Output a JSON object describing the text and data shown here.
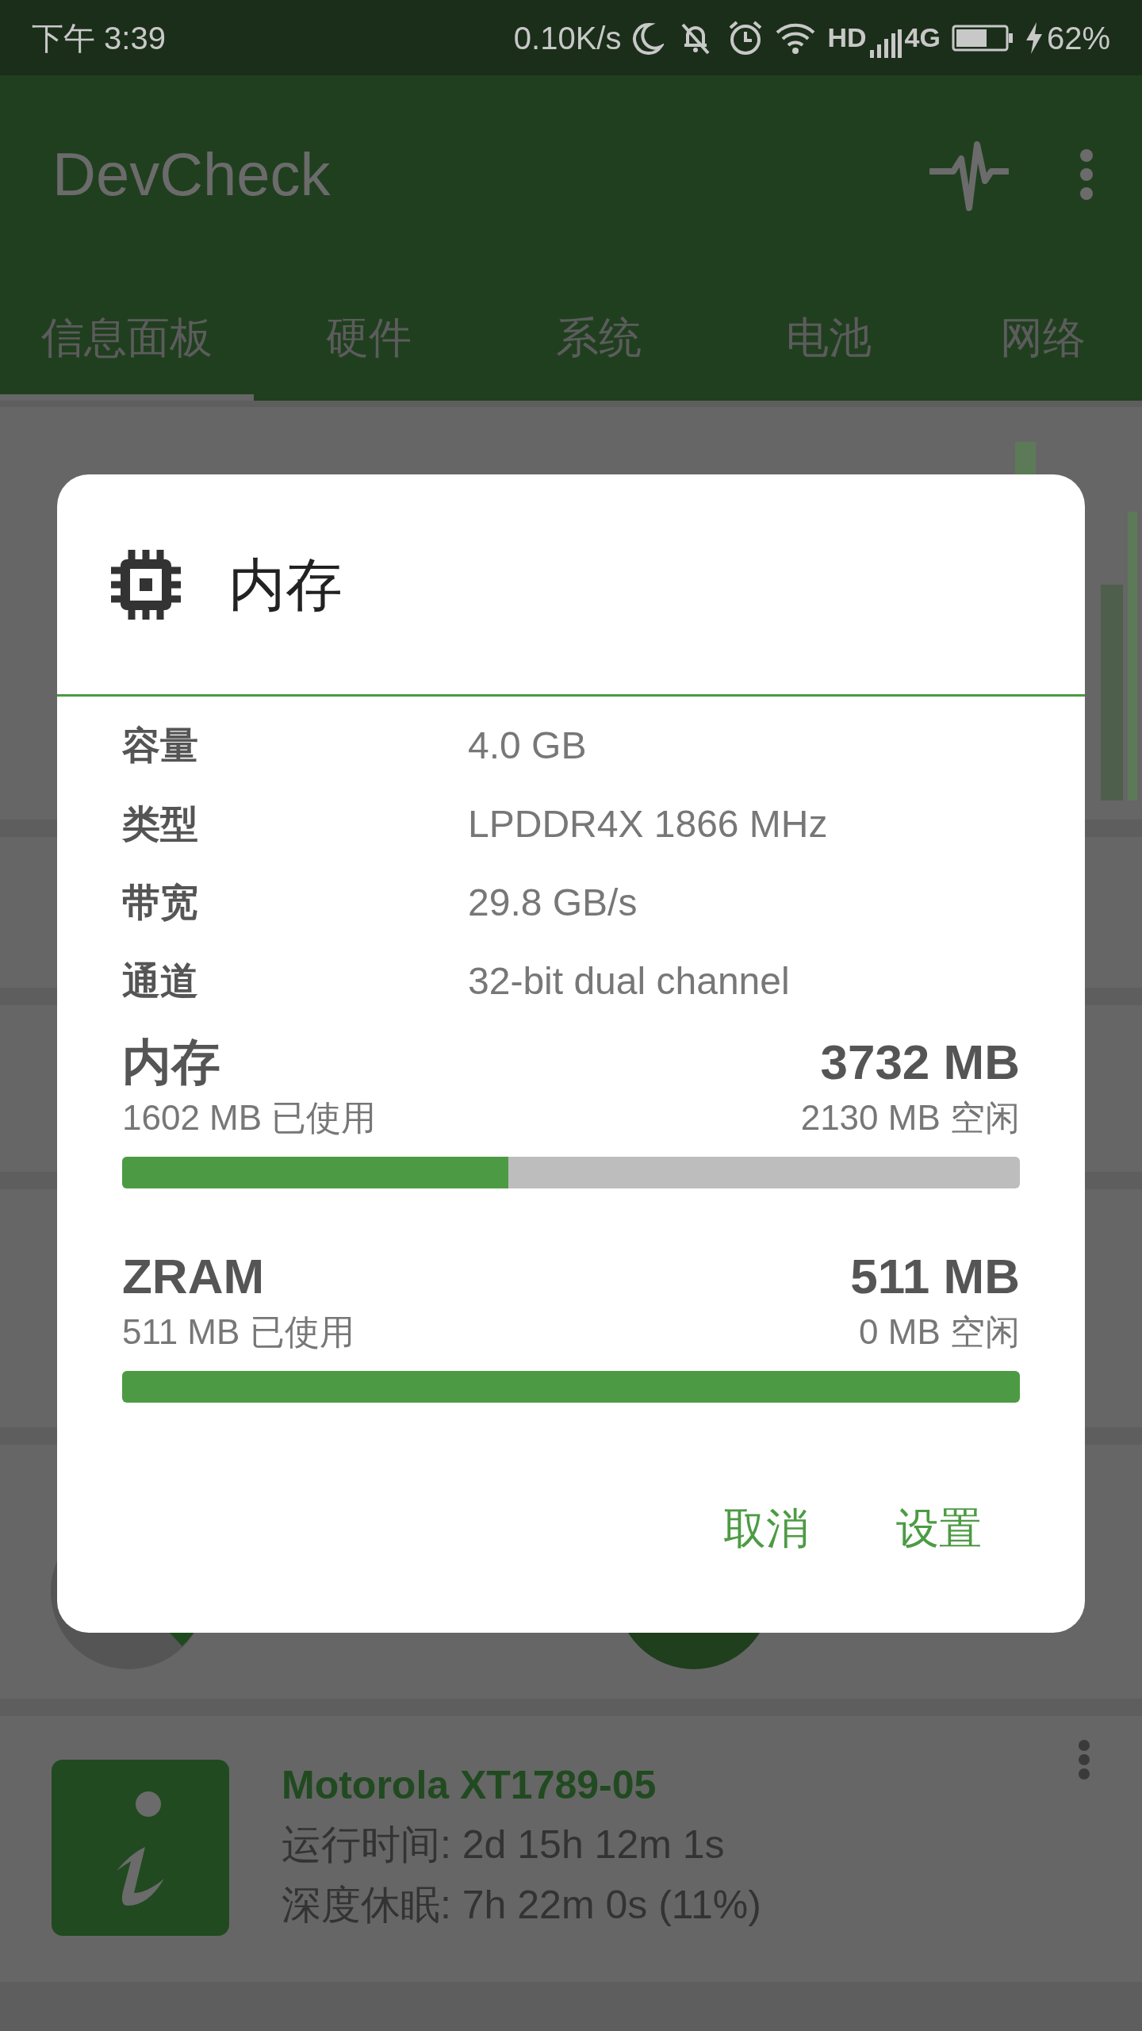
{
  "status_bar": {
    "time": "下午 3:39",
    "net_speed": "0.10K/s",
    "hd": "HD",
    "network": "4G",
    "battery": "62%"
  },
  "app_bar": {
    "title": "DevCheck"
  },
  "tabs": [
    {
      "label": "信息面板",
      "selected": true
    },
    {
      "label": "硬件",
      "selected": false
    },
    {
      "label": "系统",
      "selected": false
    },
    {
      "label": "电池",
      "selected": false
    },
    {
      "label": "网络",
      "selected": false
    }
  ],
  "dialog": {
    "title": "内存",
    "rows": [
      {
        "label": "容量",
        "value": "4.0 GB"
      },
      {
        "label": "类型",
        "value": "LPDDR4X 1866 MHz"
      },
      {
        "label": "带宽",
        "value": "29.8 GB/s"
      },
      {
        "label": "通道",
        "value": "32-bit dual channel"
      }
    ],
    "meters": [
      {
        "name": "内存",
        "total": "3732 MB",
        "used": "1602 MB 已使用",
        "free": "2130 MB 空闲",
        "level": 0.43
      },
      {
        "name": "ZRAM",
        "total": "511 MB",
        "used": "511 MB 已使用",
        "free": "0 MB 空闲",
        "level": 1
      }
    ],
    "buttons": [
      "取消",
      "设置"
    ]
  },
  "device_card": {
    "name": "Motorola XT1789-05",
    "lines": [
      "运行时间: 2d 15h 12m 1s",
      "深度休眠: 7h 22m 0s (11%)"
    ]
  }
}
